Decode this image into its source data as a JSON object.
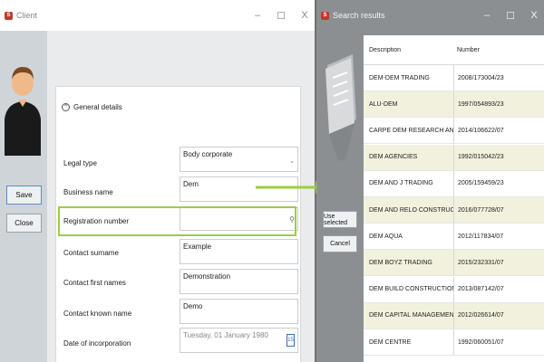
{
  "client_window": {
    "title": "Client",
    "controls": {
      "minimize": "–",
      "maximize": "☐",
      "close": "X"
    },
    "buttons": {
      "save": "Save",
      "close": "Close"
    },
    "section": {
      "expand_glyph": "^",
      "label": "General details"
    },
    "fields": {
      "legal_type": {
        "label": "Legal type",
        "value": "Body corporate"
      },
      "business_name": {
        "label": "Business name",
        "value": "Dem"
      },
      "registration_number": {
        "label": "Registration number",
        "value": ""
      },
      "contact_surname": {
        "label": "Contact surname",
        "value": "Example"
      },
      "contact_first_names": {
        "label": "Contact first names",
        "value": "Demonstration"
      },
      "contact_known_name": {
        "label": "Contact known name",
        "value": "Demo"
      },
      "date_of_incorporation": {
        "label": "Date of incorporation",
        "value": "Tuesday, 01 January 1980",
        "calendar_glyph": "15"
      }
    },
    "icons": {
      "dropdown": "chevron-down-icon",
      "lookup": "magnifier-icon",
      "calendar": "calendar-icon"
    }
  },
  "search_window": {
    "title": "Search results",
    "controls": {
      "minimize": "–",
      "maximize": "☐",
      "close": "X"
    },
    "buttons": {
      "use_selected": "Use selected",
      "cancel": "Cancel"
    },
    "columns": {
      "description": "Description",
      "number": "Number"
    },
    "rows": [
      {
        "description": "DEM-DEM TRADING",
        "number": "2008/173004/23"
      },
      {
        "description": "ALU-DEM",
        "number": "1997/054893/23"
      },
      {
        "description": "CARPE DEM RESEARCH AND BUSINESS",
        "number": "2014/106622/07"
      },
      {
        "description": "DEM AGENCIES",
        "number": "1992/015042/23"
      },
      {
        "description": "DEM AND J TRADING",
        "number": "2005/159459/23"
      },
      {
        "description": "DEM AND RELO CONSTRUCTION AND",
        "number": "2016/077728/07"
      },
      {
        "description": "DEM AQUA",
        "number": "2012/117834/07"
      },
      {
        "description": "DEM BOYZ TRADING",
        "number": "2015/232331/07"
      },
      {
        "description": "DEM BUILD CONSTRUCTION",
        "number": "2013/087142/07"
      },
      {
        "description": "DEM CAPITAL MANAGEMENT",
        "number": "2012/026614/07"
      },
      {
        "description": "DEM CENTRE",
        "number": "1992/060051/07"
      }
    ]
  },
  "colors": {
    "highlight_green": "#9ccf3c",
    "row_alt": "#f1f1dd",
    "window_dark": "#8c8f92"
  }
}
